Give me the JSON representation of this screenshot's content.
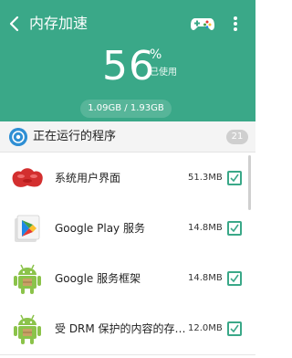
{
  "app": {
    "title": "内存加速"
  },
  "header": {
    "percent": "56",
    "percent_sign": "%",
    "percent_label": "已使用",
    "memory": "1.09GB / 1.93GB",
    "bg_color": "#3aa888",
    "usage_fraction": 0.56
  },
  "section": {
    "title": "正在运行的程序",
    "count": "21"
  },
  "apps": [
    {
      "name": "系统用户界面",
      "size": "51.3MB",
      "icon": "red-jellybean-icon",
      "checked": true
    },
    {
      "name": "Google Play 服务",
      "size": "14.8MB",
      "icon": "google-play-icon",
      "checked": true
    },
    {
      "name": "Google 服务框架",
      "size": "14.8MB",
      "icon": "android-robot-icon",
      "checked": true
    },
    {
      "name": "受 DRM 保护的内容的存…",
      "size": "12.0MB",
      "icon": "android-robot-icon",
      "checked": true
    }
  ]
}
